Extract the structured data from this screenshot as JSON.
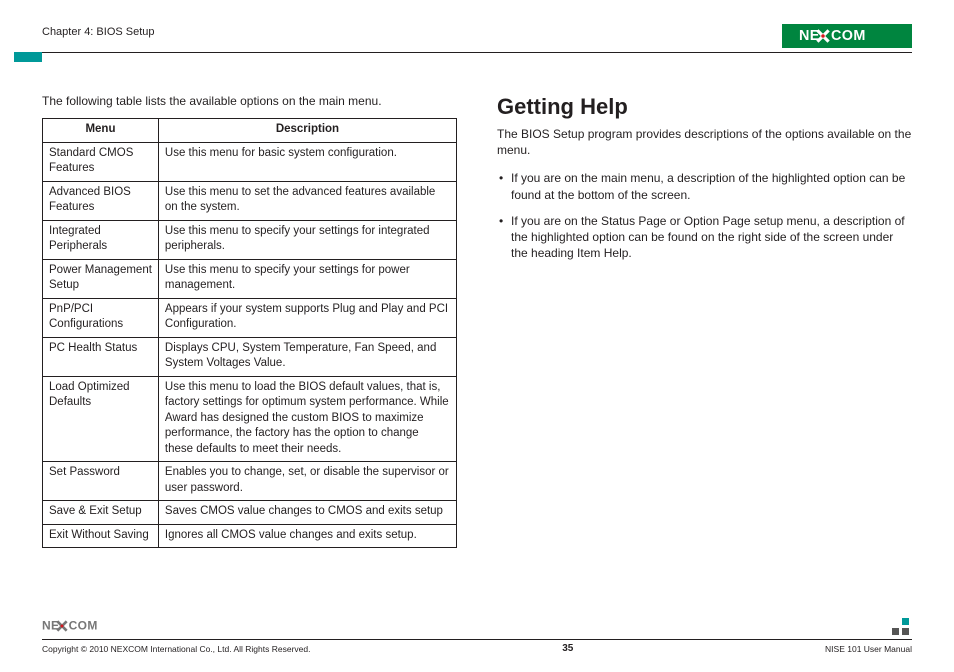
{
  "header": {
    "chapter": "Chapter 4: BIOS Setup",
    "brand_text": "NEXCOM"
  },
  "left": {
    "intro": "The following table lists the available options on the main menu.",
    "table": {
      "headers": {
        "menu": "Menu",
        "description": "Description"
      },
      "rows": [
        {
          "menu": "Standard CMOS Features",
          "desc": "Use this menu for basic system configuration."
        },
        {
          "menu": "Advanced BIOS Features",
          "desc": "Use this menu to set the advanced features available on the system."
        },
        {
          "menu": "Integrated Peripherals",
          "desc": "Use this menu to specify your settings for integrated peripherals."
        },
        {
          "menu": "Power Management Setup",
          "desc": "Use this menu to specify your settings for power management."
        },
        {
          "menu": "PnP/PCI Configurations",
          "desc": "Appears if your system supports Plug and Play and PCI Configuration."
        },
        {
          "menu": "PC Health Status",
          "desc": "Displays CPU, System Temperature, Fan Speed, and System Voltages Value."
        },
        {
          "menu": "Load Optimized Defaults",
          "desc": "Use this menu to load the BIOS default values, that is, factory settings for optimum system performance. While Award has designed the custom BIOS to maximize performance, the factory has the option to change these defaults to meet their needs."
        },
        {
          "menu": "Set Password",
          "desc": "Enables you to change, set, or disable the supervisor or user password."
        },
        {
          "menu": "Save & Exit Setup",
          "desc": "Saves CMOS value changes to CMOS and exits setup"
        },
        {
          "menu": "Exit Without Saving",
          "desc": "Ignores all CMOS value changes and exits setup."
        }
      ]
    }
  },
  "right": {
    "heading": "Getting Help",
    "intro": "The BIOS Setup program provides descriptions of the options available on the menu.",
    "bullets": [
      "If you are on the main menu, a description of the highlighted option can be found at the bottom of the screen.",
      "If you are on the Status Page or Option Page setup menu, a description of the highlighted option can be found on the right side of the screen under the heading Item Help."
    ]
  },
  "footer": {
    "brand_text": "NEXCOM",
    "copyright": "Copyright © 2010 NEXCOM International Co., Ltd. All Rights Reserved.",
    "page": "35",
    "doc": "NISE 101 User Manual"
  }
}
